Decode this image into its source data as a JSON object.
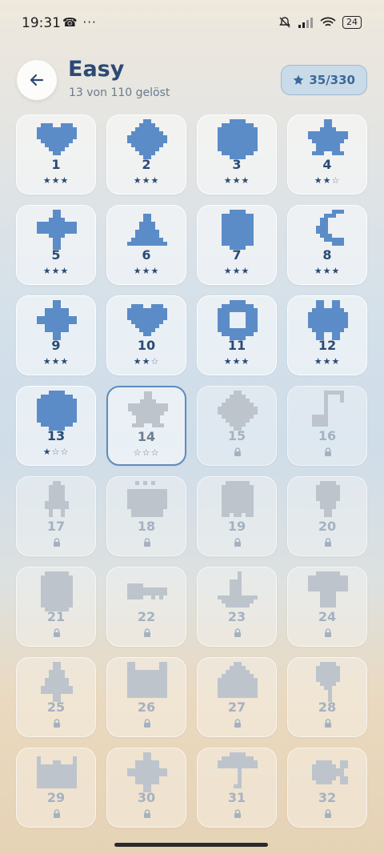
{
  "status_bar": {
    "time": "19:31",
    "left_icons": "☎ ···",
    "battery": "24"
  },
  "header": {
    "title": "Easy",
    "subtitle": "13 von 110 gelöst",
    "stars_badge": "35/330"
  },
  "colors": {
    "accent": "#2c4a74",
    "shape_blue": "#5b8cc7",
    "shape_gray": "#bdc4cc",
    "badge_bg": "#c9dbe9"
  },
  "puzzles": [
    {
      "number": "1",
      "shape": "heart",
      "status": "solved",
      "stars": 3
    },
    {
      "number": "2",
      "shape": "diamond",
      "status": "solved",
      "stars": 3
    },
    {
      "number": "3",
      "shape": "circle",
      "status": "solved",
      "stars": 3
    },
    {
      "number": "4",
      "shape": "star",
      "status": "solved",
      "stars": 2
    },
    {
      "number": "5",
      "shape": "cross",
      "status": "solved",
      "stars": 3
    },
    {
      "number": "6",
      "shape": "cone",
      "status": "solved",
      "stars": 3
    },
    {
      "number": "7",
      "shape": "hexagon",
      "status": "solved",
      "stars": 3
    },
    {
      "number": "8",
      "shape": "moon",
      "status": "solved",
      "stars": 3
    },
    {
      "number": "9",
      "shape": "spiky",
      "status": "solved",
      "stars": 3
    },
    {
      "number": "10",
      "shape": "heart",
      "status": "solved",
      "stars": 2
    },
    {
      "number": "11",
      "shape": "ring",
      "status": "solved",
      "stars": 3
    },
    {
      "number": "12",
      "shape": "gear",
      "status": "solved",
      "stars": 3
    },
    {
      "number": "13",
      "shape": "circle",
      "status": "solved",
      "stars": 1
    },
    {
      "number": "14",
      "shape": "star",
      "status": "current",
      "stars": 0
    },
    {
      "number": "15",
      "shape": "diamond",
      "status": "locked"
    },
    {
      "number": "16",
      "shape": "note",
      "status": "locked"
    },
    {
      "number": "17",
      "shape": "rocket",
      "status": "locked"
    },
    {
      "number": "18",
      "shape": "pot",
      "status": "locked"
    },
    {
      "number": "19",
      "shape": "ghost",
      "status": "locked"
    },
    {
      "number": "20",
      "shape": "bulb",
      "status": "locked"
    },
    {
      "number": "21",
      "shape": "owl",
      "status": "locked"
    },
    {
      "number": "22",
      "shape": "key",
      "status": "locked"
    },
    {
      "number": "23",
      "shape": "boat",
      "status": "locked"
    },
    {
      "number": "24",
      "shape": "mushroom",
      "status": "locked"
    },
    {
      "number": "25",
      "shape": "tree",
      "status": "locked"
    },
    {
      "number": "26",
      "shape": "cat",
      "status": "locked"
    },
    {
      "number": "27",
      "shape": "house",
      "status": "locked"
    },
    {
      "number": "28",
      "shape": "balloon",
      "status": "locked"
    },
    {
      "number": "29",
      "shape": "crown",
      "status": "locked"
    },
    {
      "number": "30",
      "shape": "spiky",
      "status": "locked"
    },
    {
      "number": "31",
      "shape": "umbrella",
      "status": "locked"
    },
    {
      "number": "32",
      "shape": "fish",
      "status": "locked"
    }
  ]
}
